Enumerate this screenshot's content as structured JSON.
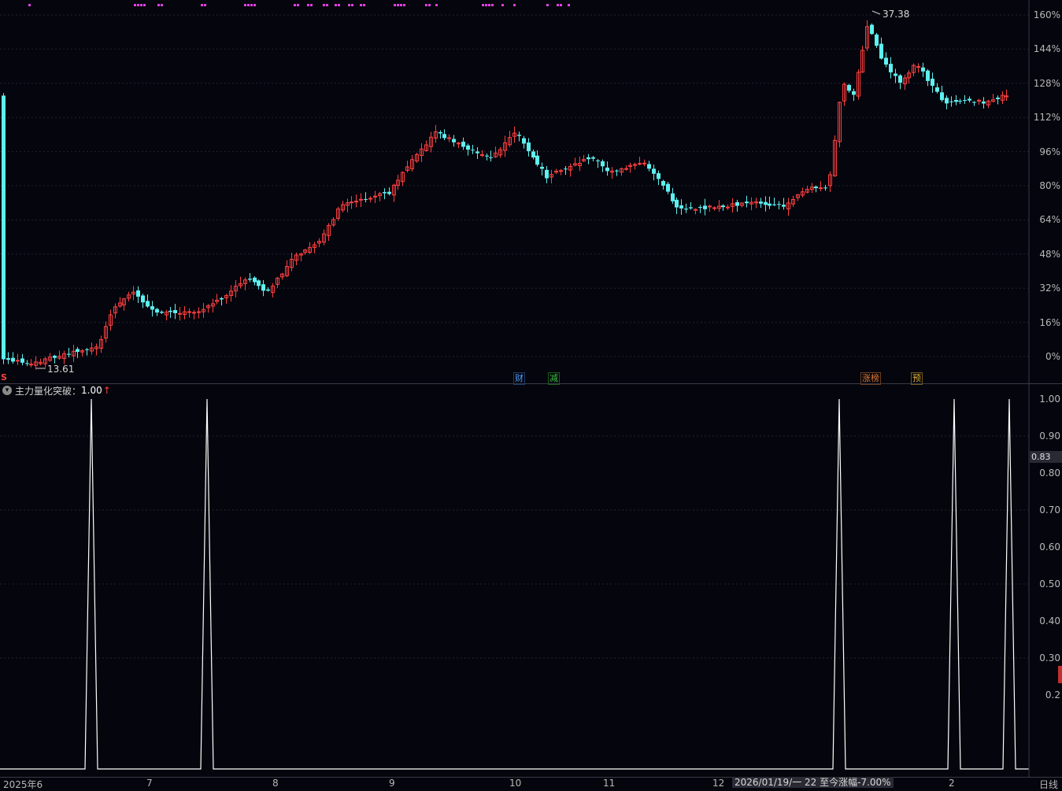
{
  "main_chart": {
    "y_axis_labels": [
      "160%",
      "144%",
      "128%",
      "112%",
      "96%",
      "80%",
      "64%",
      "48%",
      "32%",
      "16%",
      "0%"
    ],
    "high_price_label": "37.38",
    "low_price_label": "13.61",
    "corner_marker": "S",
    "event_badges": [
      {
        "text": "财",
        "color": "#4aa0ff"
      },
      {
        "text": "减",
        "color": "#3ec23e"
      },
      {
        "text": "涨榜",
        "color": "#e07b30"
      },
      {
        "text": "预",
        "color": "#e0b030"
      }
    ],
    "colors": {
      "up": "#ff4040",
      "down": "#5ef0f0",
      "signal_dots": "#e040e0",
      "grid": "#2a2a38"
    }
  },
  "indicator": {
    "title": "主力量化突破",
    "value_label": "1.00",
    "arrow_label": "↑",
    "collapse_icon": "chevron-down-icon",
    "y_axis_labels": [
      "1.00",
      "0.90",
      "0.80",
      "0.70",
      "0.60",
      "0.50",
      "0.40",
      "0.30",
      "0.2"
    ],
    "current_value_tag": "0.83"
  },
  "x_axis": {
    "labels": [
      "2025年6",
      "7",
      "8",
      "9",
      "10",
      "11",
      "12",
      "2",
      "日线"
    ],
    "status_text": "2026/01/19/一 22 至今涨幅-7.00%"
  },
  "chart_data": {
    "type": "line",
    "title": "主力量化突破",
    "xlabel": "",
    "ylabel": "",
    "ylim": [
      0,
      1.0
    ],
    "x_range": [
      0,
      1307
    ],
    "spikes": [
      {
        "x": 116,
        "y": 1.0
      },
      {
        "x": 263,
        "y": 1.0
      },
      {
        "x": 1066,
        "y": 1.0
      },
      {
        "x": 1212,
        "y": 1.0
      },
      {
        "x": 1282,
        "y": 1.0
      }
    ],
    "baseline": 0.0,
    "price_axis_percent": {
      "min": 0,
      "max": 160
    },
    "price_extremes": {
      "high": 37.38,
      "low": 13.61
    }
  }
}
